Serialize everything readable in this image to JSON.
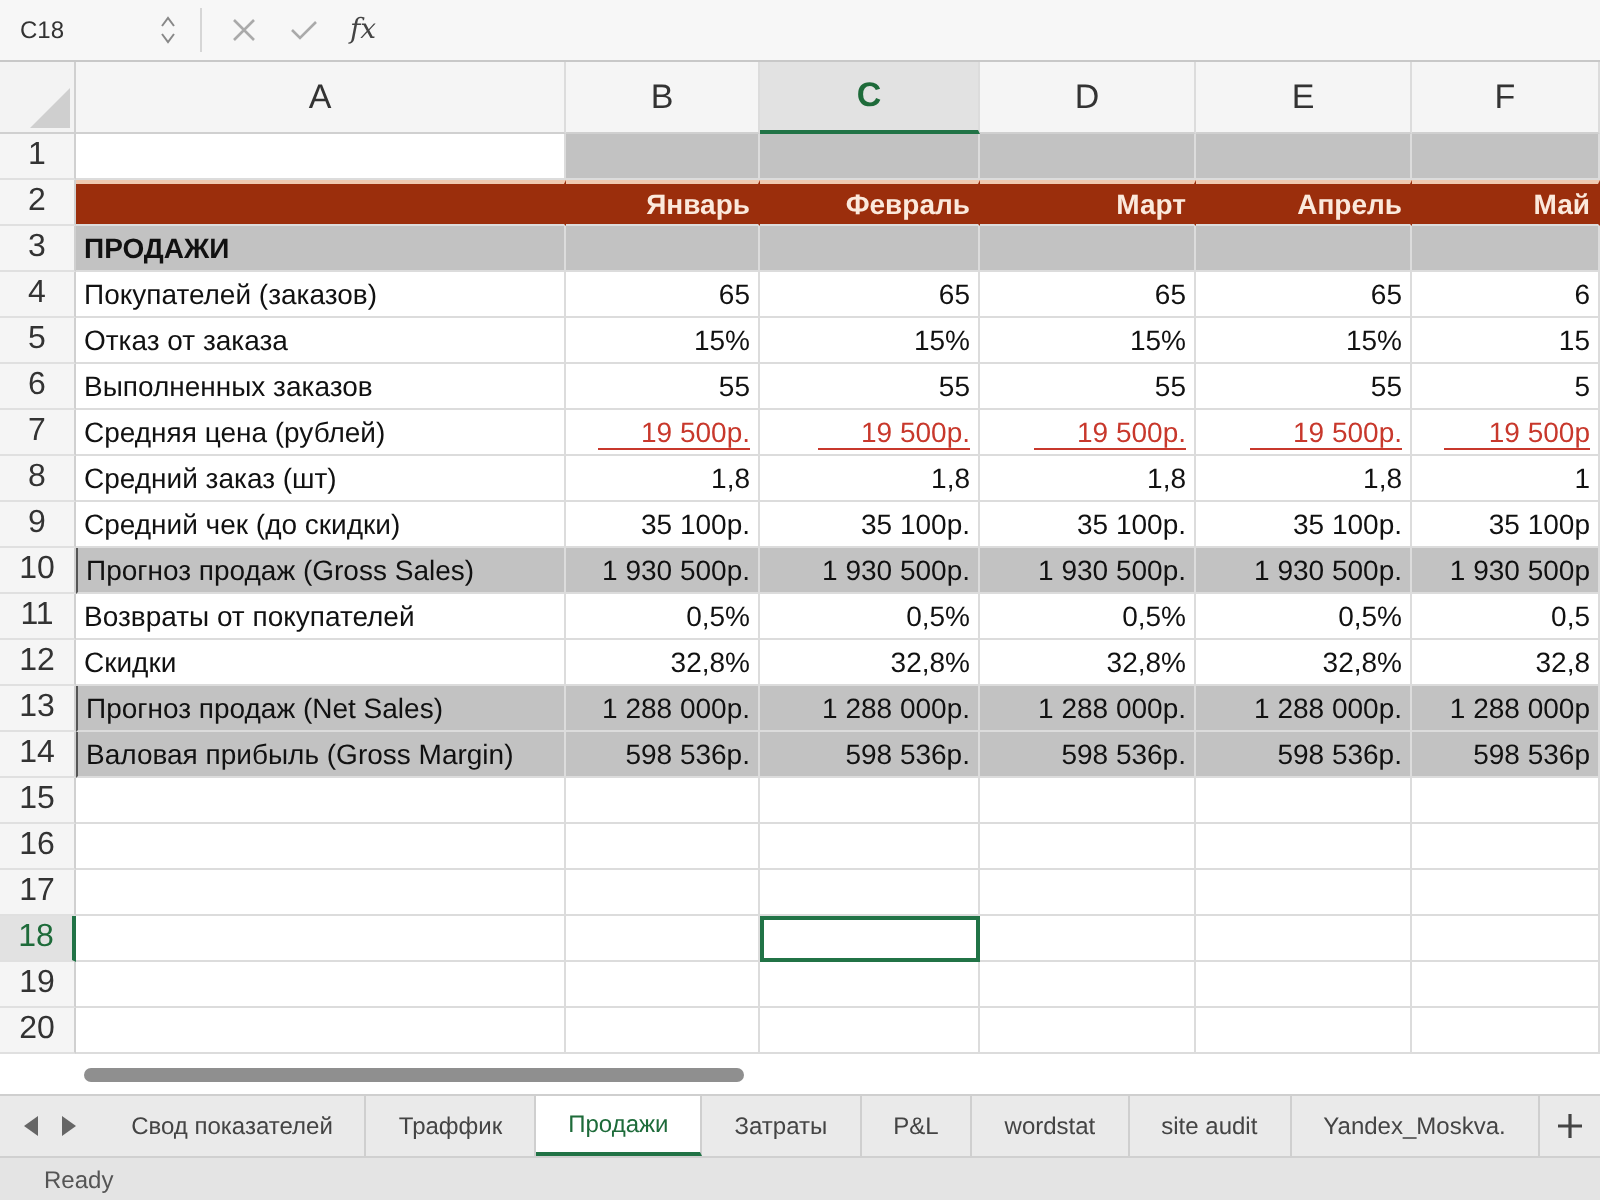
{
  "formula_bar": {
    "name_box": "C18",
    "function_label": "fx"
  },
  "columns": [
    {
      "label": "A",
      "selected": false
    },
    {
      "label": "B",
      "selected": false
    },
    {
      "label": "C",
      "selected": true
    },
    {
      "label": "D",
      "selected": false
    },
    {
      "label": "E",
      "selected": false
    },
    {
      "label": "F",
      "selected": false
    }
  ],
  "rows": [
    {
      "number": "1",
      "kind": "blank",
      "selected": false,
      "label": "",
      "cells": []
    },
    {
      "number": "2",
      "kind": "header",
      "selected": false,
      "label": "",
      "cells": [
        "Январь",
        "Февраль",
        "Март",
        "Апрель",
        "Май"
      ]
    },
    {
      "number": "3",
      "kind": "section",
      "selected": false,
      "label": "ПРОДАЖИ",
      "cells": []
    },
    {
      "number": "4",
      "kind": "data",
      "selected": false,
      "label": "Покупателей (заказов)",
      "cells": [
        "65",
        "65",
        "65",
        "65",
        "6"
      ]
    },
    {
      "number": "5",
      "kind": "data",
      "selected": false,
      "label": "Отказ от заказа",
      "cells": [
        "15%",
        "15%",
        "15%",
        "15%",
        "15"
      ]
    },
    {
      "number": "6",
      "kind": "data",
      "selected": false,
      "label": "Выполненных заказов",
      "cells": [
        "55",
        "55",
        "55",
        "55",
        "5"
      ]
    },
    {
      "number": "7",
      "kind": "input",
      "selected": false,
      "label": "Средняя цена (рублей)",
      "cells": [
        "19 500р.",
        "19 500р.",
        "19 500р.",
        "19 500р.",
        "19 500р"
      ]
    },
    {
      "number": "8",
      "kind": "data",
      "selected": false,
      "label": "Средний заказ (шт)",
      "cells": [
        "1,8",
        "1,8",
        "1,8",
        "1,8",
        "1"
      ]
    },
    {
      "number": "9",
      "kind": "data",
      "selected": false,
      "label": "Средний чек (до скидки)",
      "cells": [
        "35 100р.",
        "35 100р.",
        "35 100р.",
        "35 100р.",
        "35 100р"
      ]
    },
    {
      "number": "10",
      "kind": "total",
      "selected": false,
      "label": "Прогноз продаж (Gross Sales)",
      "cells": [
        "1 930 500р.",
        "1 930 500р.",
        "1 930 500р.",
        "1 930 500р.",
        "1 930 500р"
      ]
    },
    {
      "number": "11",
      "kind": "data",
      "selected": false,
      "label": "Возвраты от покупателей",
      "cells": [
        "0,5%",
        "0,5%",
        "0,5%",
        "0,5%",
        "0,5"
      ]
    },
    {
      "number": "12",
      "kind": "data",
      "selected": false,
      "label": "Скидки",
      "cells": [
        "32,8%",
        "32,8%",
        "32,8%",
        "32,8%",
        "32,8"
      ]
    },
    {
      "number": "13",
      "kind": "total",
      "selected": false,
      "label": "Прогноз продаж (Net Sales)",
      "cells": [
        "1 288 000р.",
        "1 288 000р.",
        "1 288 000р.",
        "1 288 000р.",
        "1 288 000р"
      ]
    },
    {
      "number": "14",
      "kind": "total",
      "selected": false,
      "label": "Валовая прибыль (Gross Margin)",
      "cells": [
        "598 536р.",
        "598 536р.",
        "598 536р.",
        "598 536р.",
        "598 536р"
      ]
    },
    {
      "number": "15",
      "kind": "empty",
      "selected": false,
      "label": "",
      "cells": [],
      "cells_selected": [
        false,
        false,
        false,
        false,
        false
      ]
    },
    {
      "number": "16",
      "kind": "empty",
      "selected": false,
      "label": "",
      "cells": [],
      "cells_selected": [
        false,
        false,
        false,
        false,
        false
      ]
    },
    {
      "number": "17",
      "kind": "empty",
      "selected": false,
      "label": "",
      "cells": [],
      "cells_selected": [
        false,
        false,
        false,
        false,
        false
      ]
    },
    {
      "number": "18",
      "kind": "empty",
      "selected": true,
      "label": "",
      "cells": [],
      "cells_selected": [
        false,
        true,
        false,
        false,
        false
      ]
    },
    {
      "number": "19",
      "kind": "empty",
      "selected": false,
      "label": "",
      "cells": [],
      "cells_selected": [
        false,
        false,
        false,
        false,
        false
      ]
    },
    {
      "number": "20",
      "kind": "empty",
      "selected": false,
      "label": "",
      "cells": [],
      "cells_selected": [
        false,
        false,
        false,
        false,
        false
      ]
    }
  ],
  "sheet_tabs": [
    {
      "label": "Свод показателей",
      "selected": false
    },
    {
      "label": "Траффик",
      "selected": false
    },
    {
      "label": "Продажи",
      "selected": true
    },
    {
      "label": "Затраты",
      "selected": false
    },
    {
      "label": "P&L",
      "selected": false
    },
    {
      "label": "wordstat",
      "selected": false
    },
    {
      "label": "site audit",
      "selected": false
    },
    {
      "label": "Yandex_Moskva.",
      "selected": false
    }
  ],
  "status_bar": {
    "text": "Ready"
  }
}
